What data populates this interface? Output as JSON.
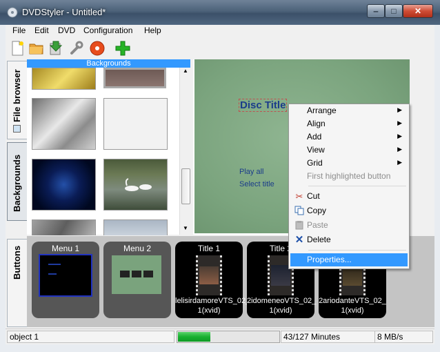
{
  "window": {
    "title": "DVDStyler - Untitled*"
  },
  "menubar": [
    "File",
    "Edit",
    "DVD",
    "Configuration",
    "Help"
  ],
  "side_tabs": {
    "file_browser": "File browser",
    "backgrounds": "Backgrounds",
    "buttons": "Buttons"
  },
  "backgrounds_panel": {
    "header": "Backgrounds"
  },
  "canvas": {
    "disc_title": "Disc Title",
    "play_all": "Play all",
    "select_title": "Select title"
  },
  "context_menu": {
    "arrange": "Arrange",
    "align": "Align",
    "add": "Add",
    "view": "View",
    "grid": "Grid",
    "first_highlighted": "First highlighted button",
    "cut": "Cut",
    "copy": "Copy",
    "paste": "Paste",
    "delete": "Delete",
    "properties": "Properties..."
  },
  "titleset": {
    "menu1": {
      "title": "Menu 1"
    },
    "menu2": {
      "title": "Menu 2"
    },
    "title1": {
      "title": "Title 1",
      "caption": "lelisirdamoreVTS_02_1(xvid)"
    },
    "title2": {
      "title": "Title 2",
      "caption": "2idomeneoVTS_02_1(xvid)"
    },
    "title3": {
      "caption": "2ariodanteVTS_02_1(xvid)"
    }
  },
  "status": {
    "object": "object 1",
    "progress_percent": 32,
    "minutes": "43/127 Minutes",
    "rate": "8 MB/s"
  },
  "colors": {
    "accent": "#3399ff",
    "menu_bg": "#7ba47e",
    "progress": "#22c23a"
  }
}
